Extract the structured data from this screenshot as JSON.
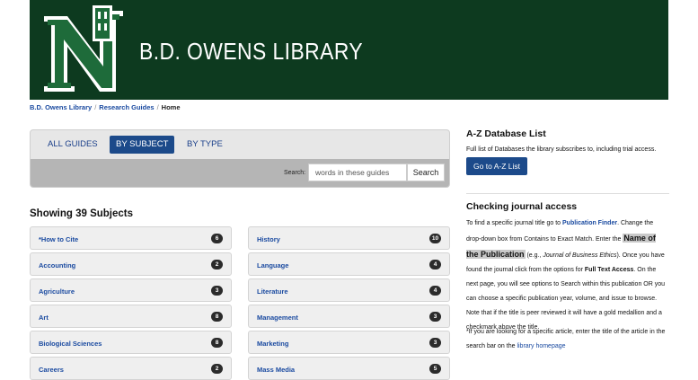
{
  "banner": {
    "title": "B.D. OWENS LIBRARY"
  },
  "breadcrumb": {
    "items": [
      "B.D. Owens Library",
      "Research Guides",
      "Home"
    ]
  },
  "guides": {
    "tabs": [
      "ALL GUIDES",
      "BY SUBJECT",
      "BY TYPE"
    ],
    "active_tab": "BY SUBJECT",
    "search_label": "Search:",
    "search_placeholder": "words in these guides",
    "search_button": "Search"
  },
  "subjects": {
    "heading": "Showing 39 Subjects",
    "left": [
      {
        "label": "*How to Cite",
        "count": "6"
      },
      {
        "label": "Accounting",
        "count": "2"
      },
      {
        "label": "Agriculture",
        "count": "3"
      },
      {
        "label": "Art",
        "count": "8"
      },
      {
        "label": "Biological Sciences",
        "count": "8"
      },
      {
        "label": "Careers",
        "count": "2"
      }
    ],
    "right": [
      {
        "label": "History",
        "count": "10"
      },
      {
        "label": "Language",
        "count": "4"
      },
      {
        "label": "Literature",
        "count": "4"
      },
      {
        "label": "Management",
        "count": "3"
      },
      {
        "label": "Marketing",
        "count": "3"
      },
      {
        "label": "Mass Media",
        "count": "5"
      }
    ]
  },
  "sidebar": {
    "az_heading": "A-Z Database List",
    "az_text": "Full list of Databases the library subscribes to, including trial access.",
    "az_button": "Go to A-Z List",
    "journal_heading": "Checking journal access",
    "p1_a": "To find a specific journal title go to ",
    "p1_link": "Publication Finder",
    "p1_b": ". Change the drop-down box from Contains to Exact Match. Enter the ",
    "p1_hl": "Name of the Publication",
    "p1_c": " (e.g., ",
    "p1_ital": "Journal of Business Ethics",
    "p1_d": "). Once you have found the journal click from the options for ",
    "p1_bold": "Full Text Access",
    "p1_e": ". On the next page, you will see options to Search within this publication OR you can choose a specific publication year, volume, and issue to browse. Note that if the title is peer reviewed it will have a gold medallion and a checkmark above the title.",
    "p2_a": "*If you are looking for a specific article, enter the title of the article in the search bar on the ",
    "p2_link": "library homepage"
  },
  "colors": {
    "banner": "#0d3a1f",
    "accent": "#1c4a8a",
    "link": "#1a4aa0"
  },
  "icons": {
    "logo": "northwest-n-logo"
  }
}
